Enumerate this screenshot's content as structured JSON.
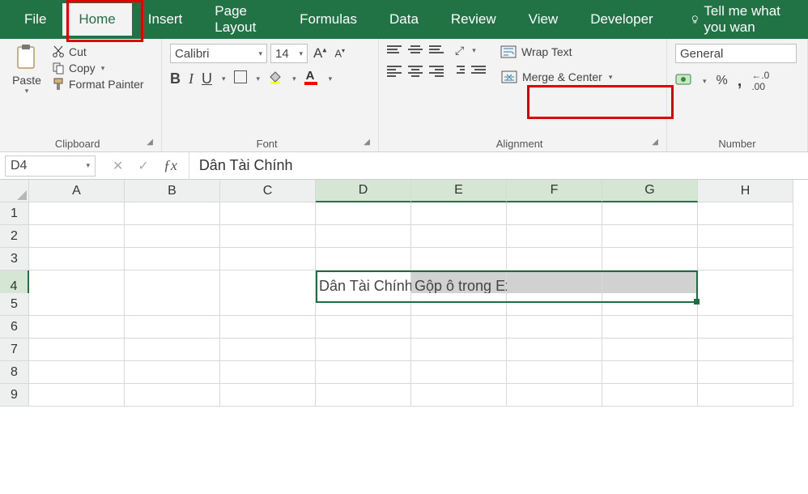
{
  "tabs": {
    "file": "File",
    "home": "Home",
    "insert": "Insert",
    "page_layout": "Page Layout",
    "formulas": "Formulas",
    "data": "Data",
    "review": "Review",
    "view": "View",
    "developer": "Developer",
    "tellme": "Tell me what you wan"
  },
  "clipboard": {
    "paste": "Paste",
    "cut": "Cut",
    "copy": "Copy",
    "format_painter": "Format Painter",
    "label": "Clipboard"
  },
  "font": {
    "name": "Calibri",
    "size": "14",
    "bold": "B",
    "italic": "I",
    "underline": "U",
    "label": "Font"
  },
  "alignment": {
    "wrap": "Wrap Text",
    "merge": "Merge & Center",
    "label": "Alignment"
  },
  "number": {
    "format": "General",
    "percent": "%",
    "comma": ",",
    "inc_dec": ".0",
    "label": "Number"
  },
  "formula_bar": {
    "cell_ref": "D4",
    "formula": "Dân Tài Chính"
  },
  "columns": [
    "A",
    "B",
    "C",
    "D",
    "E",
    "F",
    "G",
    "H"
  ],
  "rows": [
    "1",
    "2",
    "3",
    "4",
    "5",
    "6",
    "7",
    "8",
    "9"
  ],
  "cells": {
    "D4": "Dân Tài Chính",
    "E4": "Gộp ô trong Excel"
  },
  "selection": {
    "from": "D4",
    "to": "G4"
  }
}
